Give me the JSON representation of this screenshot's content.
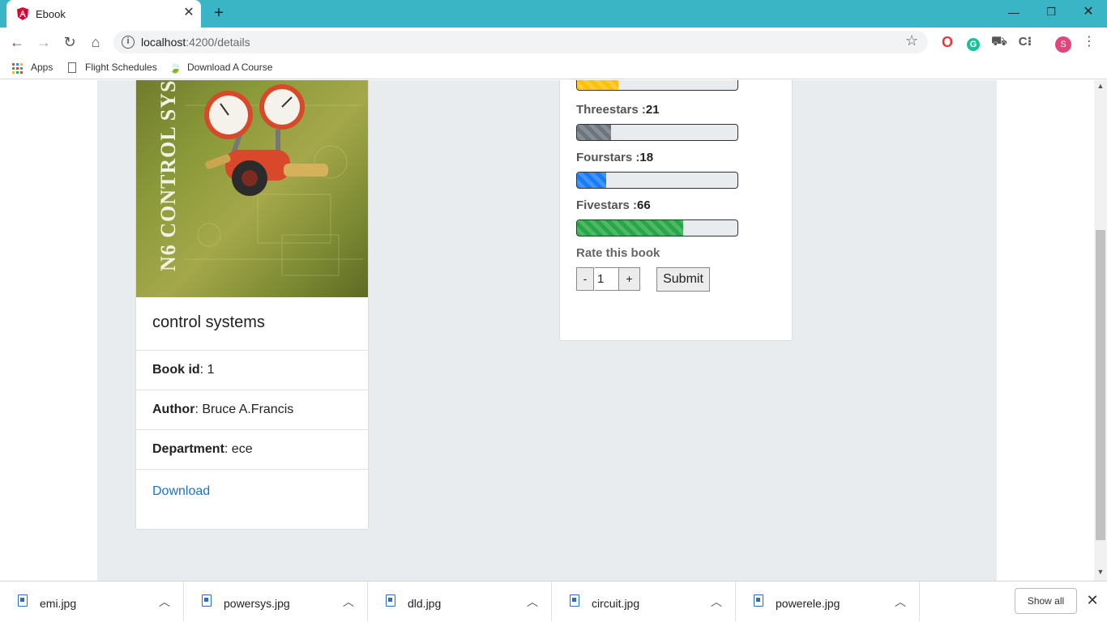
{
  "browser": {
    "tab_title": "Ebook",
    "url_host": "localhost",
    "url_path": ":4200/details",
    "bookmarks": [
      {
        "label": "Apps"
      },
      {
        "label": "Flight Schedules"
      },
      {
        "label": "Download A Course"
      }
    ],
    "profile_initial": "S"
  },
  "book": {
    "cover_title": "N6 CONTROL SYST",
    "title": "control systems",
    "book_id_label": "Book id",
    "book_id_value": ": 1",
    "author_label": "Author",
    "author_value": ": Bruce A.Francis",
    "department_label": "Department",
    "department_value": ": ece",
    "download_label": "Download"
  },
  "ratings": {
    "rows": [
      {
        "name": "Threestars :",
        "count": "21",
        "fraction": 0.21,
        "color": "#6c757d"
      },
      {
        "name": "Fourstars :",
        "count": "18",
        "fraction": 0.18,
        "color": "#1a7cf5"
      },
      {
        "name": "Fivestars :",
        "count": "66",
        "fraction": 0.66,
        "color": "#28a745"
      }
    ],
    "partial_top_color": "#ffc107",
    "partial_top_fraction": 0.26,
    "rate_label": "Rate this book",
    "minus_label": "-",
    "plus_label": "+",
    "rate_value": "1",
    "submit_label": "Submit"
  },
  "downloads": {
    "items": [
      {
        "name": "emi.jpg"
      },
      {
        "name": "powersys.jpg"
      },
      {
        "name": "dld.jpg"
      },
      {
        "name": "circuit.jpg"
      },
      {
        "name": "powerele.jpg"
      }
    ],
    "show_all_label": "Show all"
  }
}
